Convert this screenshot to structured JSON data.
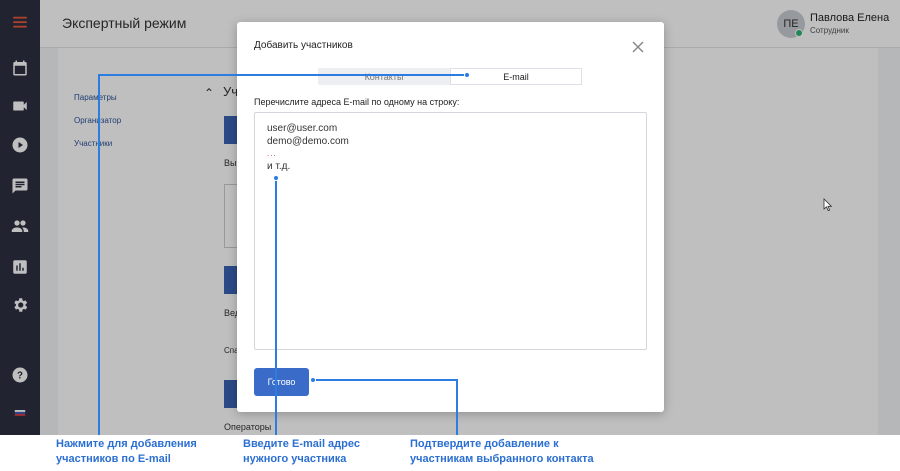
{
  "topbar": {
    "title": "Экспертный режим"
  },
  "user": {
    "initials": "ПЕ",
    "name": "Павлова Елена",
    "role": "Сотрудник"
  },
  "left_nav": {
    "items": [
      {
        "label": "Параметры"
      },
      {
        "label": "Организатор"
      },
      {
        "label": "Участники"
      }
    ]
  },
  "background": {
    "section_partial": "Уч",
    "text_vy": "Вы",
    "text_ved": "Вед",
    "text_spa": "Спа",
    "operators": "Операторы"
  },
  "modal": {
    "title": "Добавить участников",
    "tabs": [
      {
        "label": "Контакты"
      },
      {
        "label": "E-mail"
      }
    ],
    "active_tab": "E-mail",
    "field_label": "Перечислите адреса E-mail по одному на строку:",
    "textarea_lines": [
      "user@user.com",
      "demo@demo.com",
      "...",
      "и т.д."
    ],
    "done_label": "Готово"
  },
  "captions": {
    "email_tab": [
      "Нажмите для добавления",
      "участников по E-mail"
    ],
    "email_input": [
      "Введите E-mail адрес",
      "нужного участника"
    ],
    "confirm": [
      "Подтвердите добавление к",
      "участникам выбранного контакта"
    ]
  },
  "colors": {
    "accent": "#3a6bc8",
    "callout": "#2b7de1",
    "sidebar": "#2c3140"
  }
}
